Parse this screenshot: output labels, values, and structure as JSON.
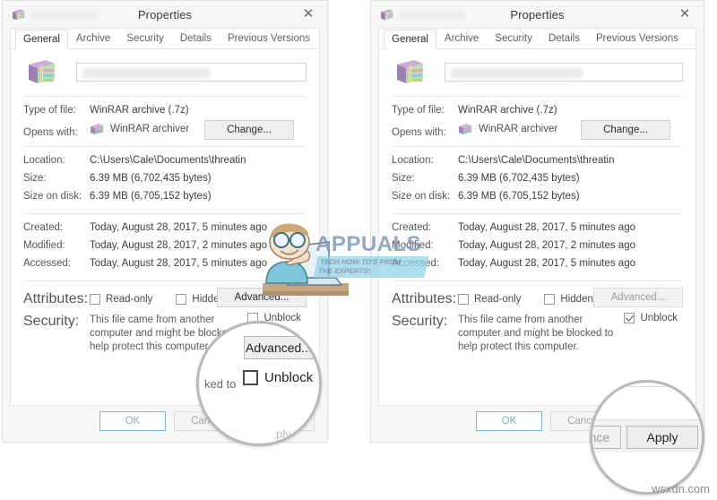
{
  "window_title": "Properties",
  "close_icon": "close-icon",
  "title_icon": "winrar-archive-icon",
  "tabs": [
    {
      "label": "General",
      "selected": true
    },
    {
      "label": "Archive",
      "selected": false
    },
    {
      "label": "Security",
      "selected": false
    },
    {
      "label": "Details",
      "selected": false
    },
    {
      "label": "Previous Versions",
      "selected": false
    }
  ],
  "filename_field": {
    "value": "",
    "placeholder": ""
  },
  "details": {
    "type_of_file_label": "Type of file:",
    "type_of_file_value": "WinRAR archive (.7z)",
    "opens_with_label": "Opens with:",
    "opens_with_value": "WinRAR archiver",
    "change_button": "Change...",
    "location_label": "Location:",
    "location_value": "C:\\Users\\Cale\\Documents\\threatin",
    "size_label": "Size:",
    "size_value": "6.39 MB (6,702,435 bytes)",
    "size_on_disk_label": "Size on disk:",
    "size_on_disk_value": "6.39 MB (6,705,152 bytes)",
    "created_label": "Created:",
    "created_value": "Today, August 28, 2017, 5 minutes ago",
    "modified_label": "Modified:",
    "modified_value": "Today, August 28, 2017, 2 minutes ago",
    "accessed_label": "Accessed:",
    "accessed_value": "Today, August 28, 2017, 5 minutes ago"
  },
  "attributes": {
    "label": "Attributes:",
    "read_only_label": "Read-only",
    "read_only_checked": false,
    "hidden_label": "Hidden",
    "hidden_checked": false,
    "advanced_button": "Advanced..."
  },
  "security": {
    "label": "Security:",
    "message": "This file came from another computer and might be blocked to help protect this computer.",
    "unblock_label": "Unblock"
  },
  "footer": {
    "ok": "OK",
    "cancel": "Cancel",
    "apply": "Apply"
  },
  "left_panel": {
    "unblock_checked": false,
    "magnifier": {
      "advanced_button": "Advanced...",
      "unblock_label": "Unblock",
      "unblock_checked": false,
      "ghost_text_left": "ked to",
      "ghost_text_bottom": "ply"
    }
  },
  "right_panel": {
    "unblock_checked": true,
    "magnifier": {
      "apply_button": "Apply",
      "cancel_fragment": "ance"
    }
  },
  "watermarks": {
    "brand": "APPUALS",
    "tagline_line1": "TECH HOW-TO'S FROM",
    "tagline_line2": "THE EXPERTS!",
    "site": "wsxdn.com"
  },
  "colors": {
    "accent_focus": "#7fb4e0",
    "window_bg": "#f7f7f7",
    "page_bg": "#ffffff",
    "text": "#3c3c3c",
    "muted": "#8a8a8a",
    "brand": "#7f95b0",
    "band": "#8fd3e8"
  }
}
